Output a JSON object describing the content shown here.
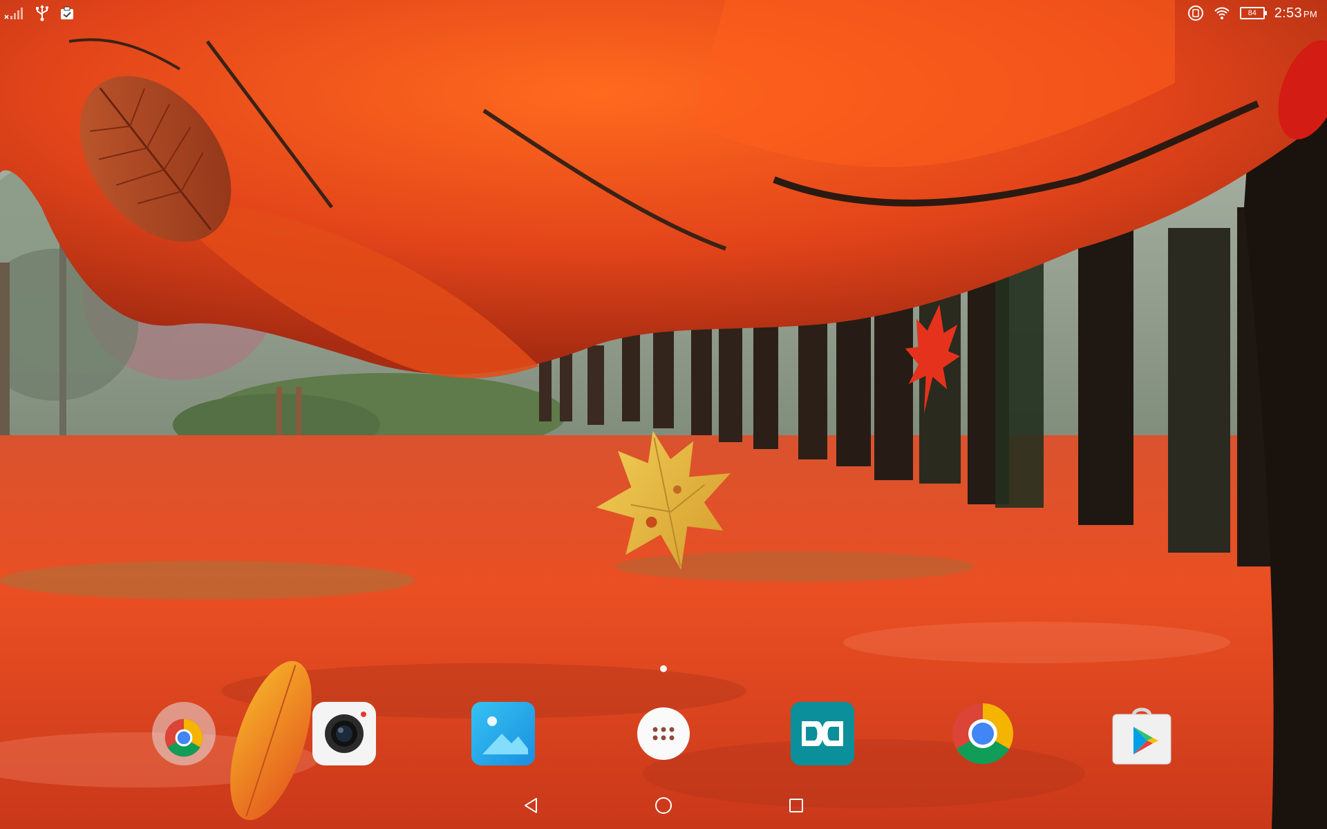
{
  "status_bar": {
    "time": "2:53",
    "ampm": "PM",
    "battery_level": "84",
    "left_icons": [
      "signal-off-icon",
      "usb-icon",
      "clipboard-icon"
    ],
    "right_icons": [
      "screenshot-icon",
      "wifi-icon",
      "battery-icon"
    ]
  },
  "wallpaper": {
    "scene": "autumn-park",
    "colors": {
      "canopy": "#e1471a",
      "ground": "#e84a25",
      "trunks": "#2a1d16",
      "fog": "#9aa39a",
      "leaf_yellow": "#e9b43a"
    }
  },
  "home": {
    "page_count": 1,
    "current_page": 1
  },
  "dock": {
    "apps": [
      {
        "icon": "chrome-in-folder-icon"
      },
      {
        "icon": "camera-icon"
      },
      {
        "icon": "gallery-icon"
      },
      {
        "icon": "app-drawer-icon"
      },
      {
        "icon": "dolby-icon"
      },
      {
        "icon": "chrome-icon"
      },
      {
        "icon": "play-store-icon"
      }
    ]
  },
  "nav_bar": {
    "buttons": [
      "back-icon",
      "home-icon",
      "recents-icon"
    ]
  }
}
